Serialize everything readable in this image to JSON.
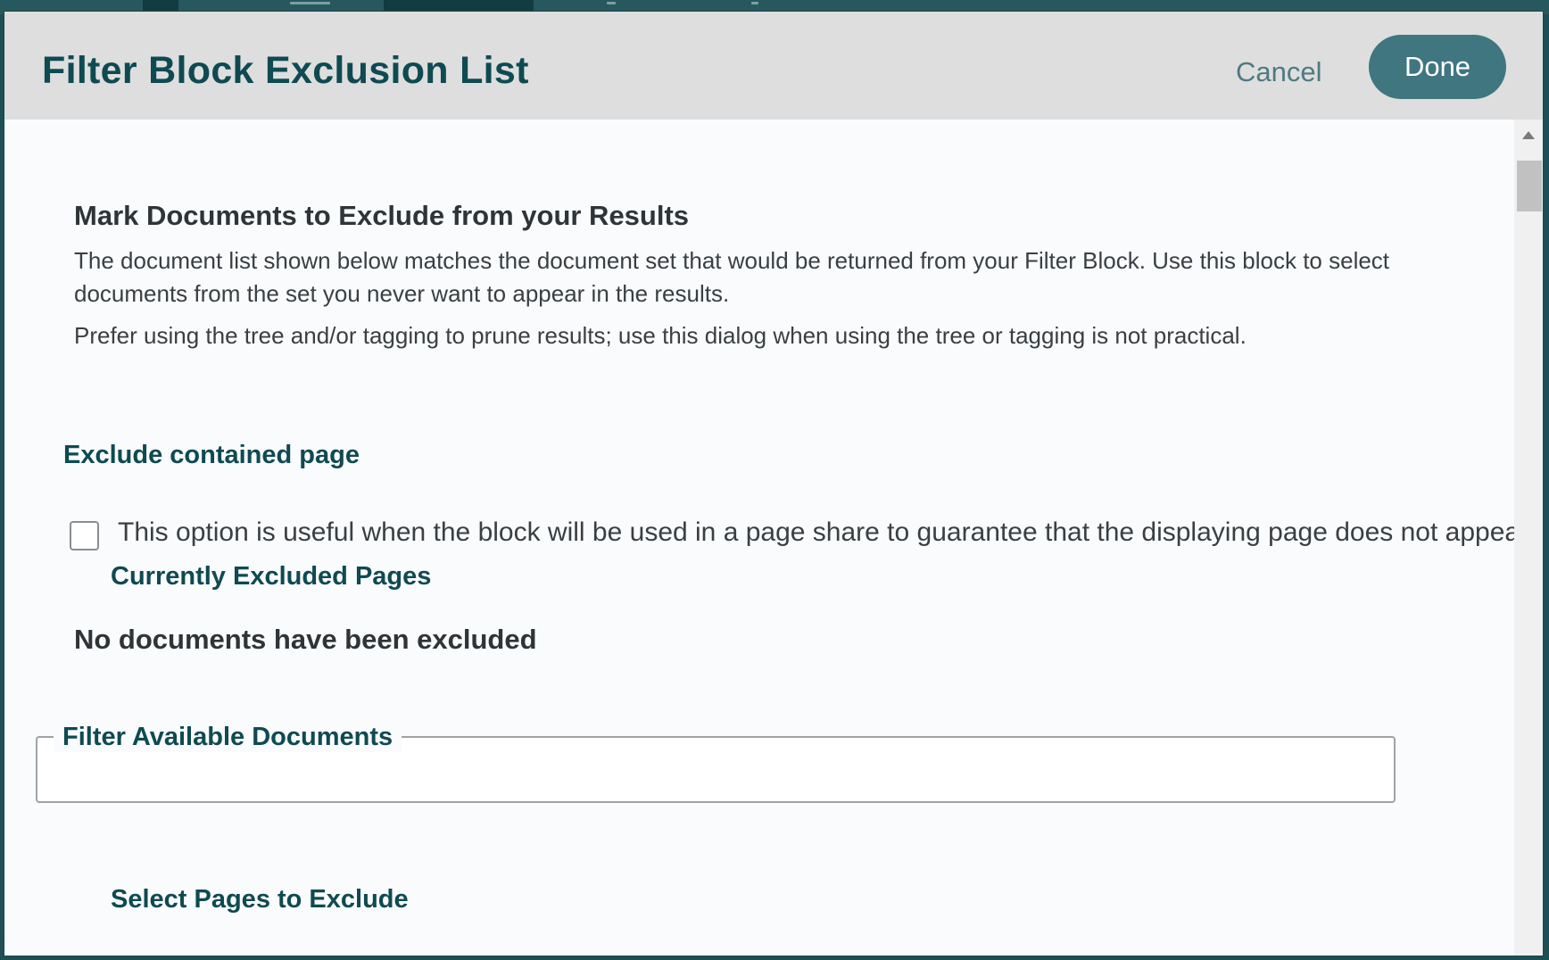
{
  "dialog": {
    "title": "Filter Block Exclusion List",
    "cancel_label": "Cancel",
    "done_label": "Done"
  },
  "content": {
    "section_title": "Mark Documents to Exclude from your Results",
    "description": "The document list shown below matches the document set that would be returned from your Filter Block. Use this block to select documents from the set you never want to appear in the results.",
    "hint": "Prefer using the tree and/or tagging to prune results; use this dialog when using the tree or tagging is not practical.",
    "exclude_contained": {
      "heading": "Exclude contained page",
      "checkbox_label": "This option is useful when the block will be used in a page share to guarantee that the displaying page does not appea",
      "checked": false
    },
    "currently_excluded": {
      "heading": "Currently Excluded Pages",
      "empty_message": "No documents have been excluded"
    },
    "filter": {
      "legend": "Filter Available Documents",
      "value": ""
    },
    "select_heading": "Select Pages to Exclude"
  },
  "colors": {
    "accent": "#0f4a52",
    "done_button": "#3f7680",
    "header_bg": "#dedede"
  }
}
